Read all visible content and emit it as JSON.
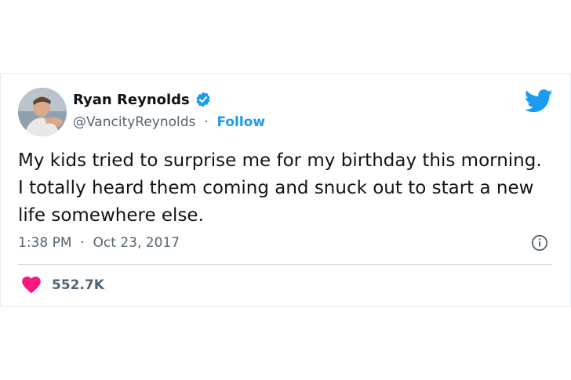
{
  "tweet": {
    "author_name": "Ryan Reynolds",
    "handle": "@VancityReynolds",
    "separator": "·",
    "follow_label": "Follow",
    "text": "My kids tried to surprise me for my birthday this morning. I totally heard them coming and snuck out to start a new life somewhere else.",
    "time": "1:38 PM",
    "date": "Oct 23, 2017",
    "likes": "552.7K"
  },
  "icons": {
    "verified": "verified-badge-icon",
    "bird": "twitter-bird-icon",
    "info": "info-icon",
    "heart": "heart-icon"
  },
  "colors": {
    "accent": "#1d9bf0",
    "heart": "#f91880",
    "secondary_text": "#536471"
  }
}
